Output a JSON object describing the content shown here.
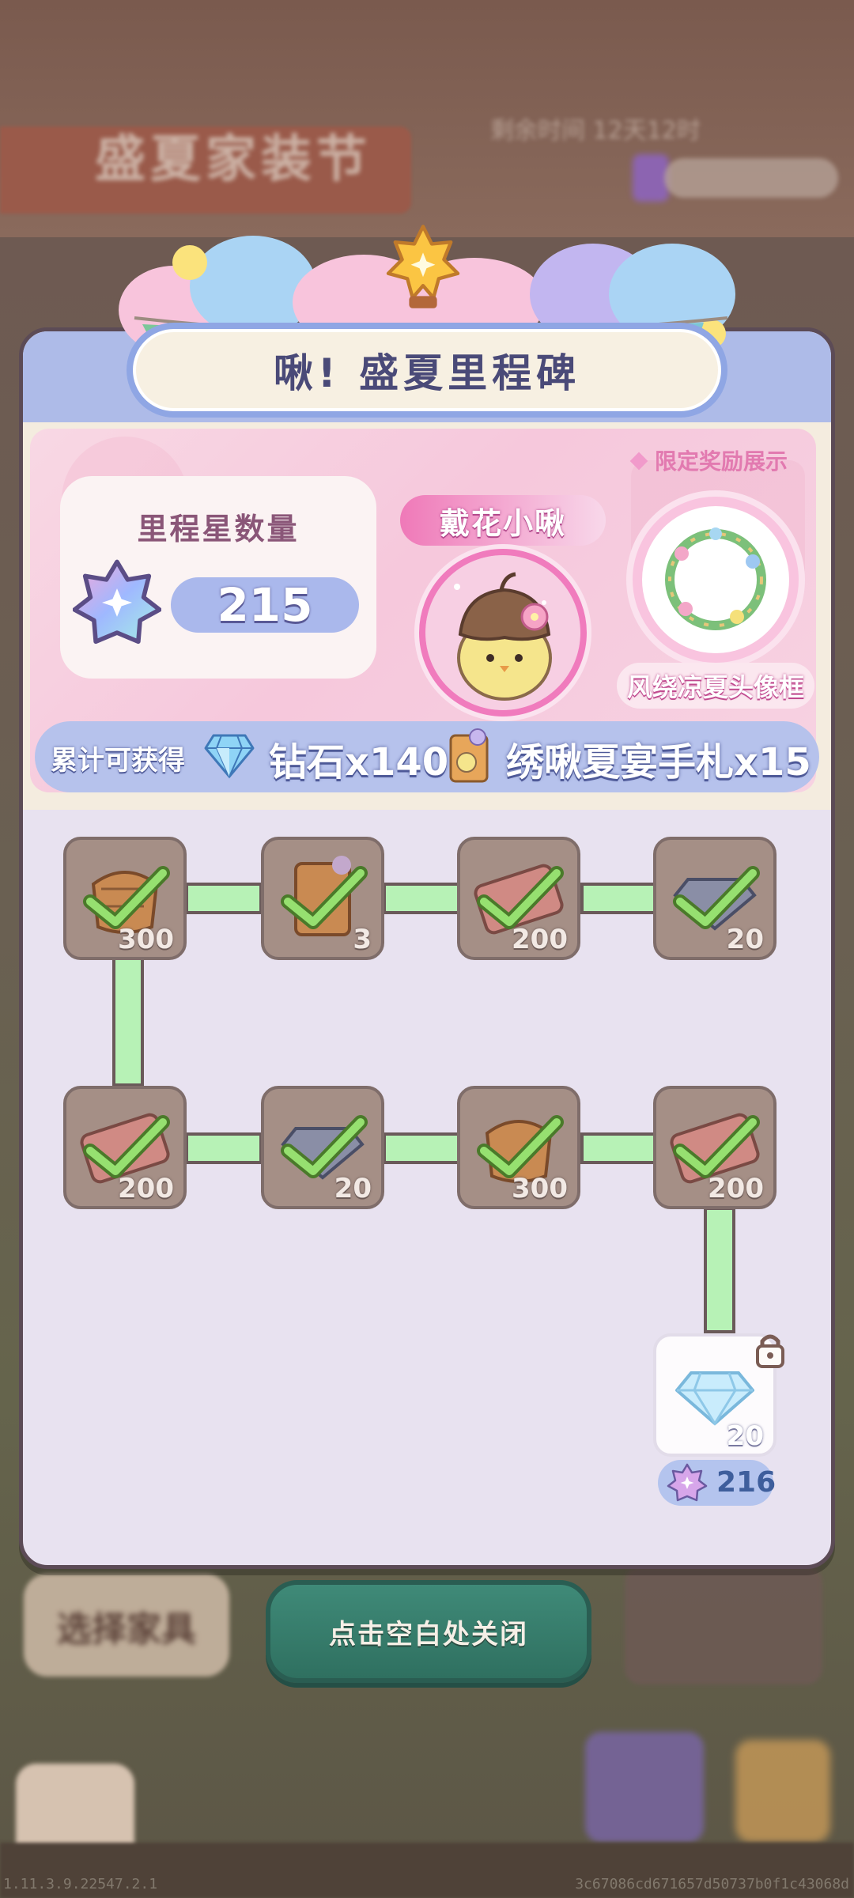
{
  "background": {
    "event_title": "盛夏家装节",
    "timer_text": "剩余时间 12天12时",
    "left_button": "选择家具",
    "debug_left": "1.11.3.9.22547.2.1",
    "debug_right": "3c67086cd671657d50737b0f1c43068d"
  },
  "close_hint": "点击空白处关闭",
  "panel": {
    "title": "啾! 盛夏里程碑",
    "limited_label": "限定奖励展示",
    "count_title": "里程星数量",
    "count_value": "215",
    "avatar_name": "戴花小啾",
    "frame_name": "风绕凉夏头像框",
    "total_label": "累计可获得",
    "total_diamond": "钻石x140",
    "total_card": "绣啾夏宴手札x15"
  },
  "milestones": [
    {
      "reward": "bread",
      "qty": "300",
      "claimed": true
    },
    {
      "reward": "card",
      "qty": "3",
      "claimed": true
    },
    {
      "reward": "ticket",
      "qty": "200",
      "claimed": true
    },
    {
      "reward": "diamond",
      "qty": "20",
      "claimed": true
    },
    {
      "reward": "ticket",
      "qty": "200",
      "claimed": true
    },
    {
      "reward": "diamond",
      "qty": "20",
      "claimed": true
    },
    {
      "reward": "bread",
      "qty": "300",
      "claimed": true
    },
    {
      "reward": "ticket",
      "qty": "200",
      "claimed": true
    },
    {
      "reward": "diamond",
      "qty": "20",
      "claimed": false,
      "requirement": "216"
    }
  ],
  "colors": {
    "header": "#aebbe8",
    "reward_bg": "#f6c8dc",
    "path": "#b7f2b6",
    "check": "#8ee070"
  }
}
